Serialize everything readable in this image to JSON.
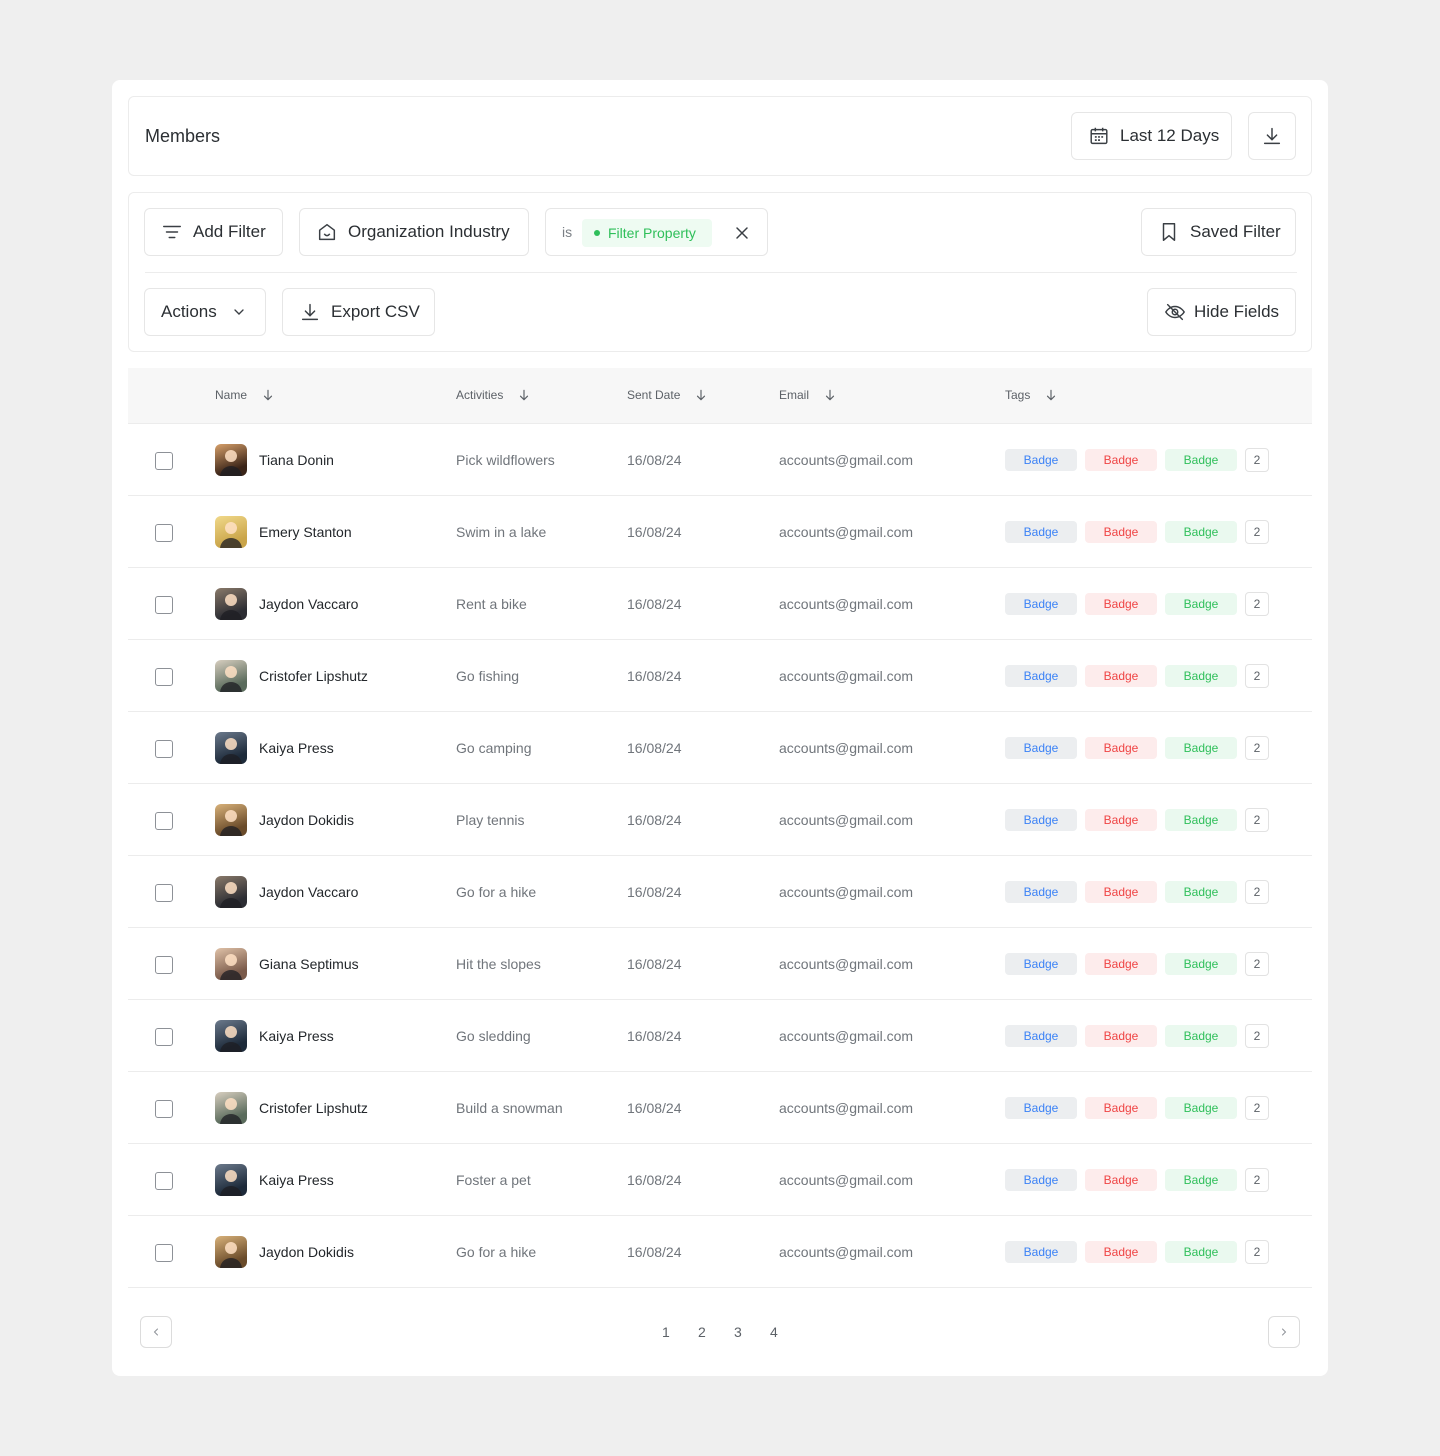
{
  "header": {
    "title": "Members",
    "date_range_label": "Last 12 Days"
  },
  "filters": {
    "add_filter_label": "Add Filter",
    "org_industry_label": "Organization Industry",
    "condition_operator": "is",
    "condition_value": "Filter Property",
    "saved_filter_label": "Saved Filter",
    "actions_label": "Actions",
    "export_csv_label": "Export CSV",
    "hide_fields_label": "Hide Fields"
  },
  "table": {
    "columns": [
      "Name",
      "Activities",
      "Sent Date",
      "Email",
      "Tags"
    ],
    "badge_labels": [
      "Badge",
      "Badge",
      "Badge"
    ],
    "rows": [
      {
        "name": "Tiana Donin",
        "activity": "Pick wildflowers",
        "date": "16/08/24",
        "email": "accounts@gmail.com",
        "tag_count": "2"
      },
      {
        "name": "Emery Stanton",
        "activity": "Swim in a lake",
        "date": "16/08/24",
        "email": "accounts@gmail.com",
        "tag_count": "2"
      },
      {
        "name": "Jaydon Vaccaro",
        "activity": "Rent a bike",
        "date": "16/08/24",
        "email": "accounts@gmail.com",
        "tag_count": "2"
      },
      {
        "name": "Cristofer Lipshutz",
        "activity": "Go fishing",
        "date": "16/08/24",
        "email": "accounts@gmail.com",
        "tag_count": "2"
      },
      {
        "name": "Kaiya Press",
        "activity": "Go camping",
        "date": "16/08/24",
        "email": "accounts@gmail.com",
        "tag_count": "2"
      },
      {
        "name": "Jaydon Dokidis",
        "activity": "Play tennis",
        "date": "16/08/24",
        "email": "accounts@gmail.com",
        "tag_count": "2"
      },
      {
        "name": "Jaydon Vaccaro",
        "activity": "Go for a hike",
        "date": "16/08/24",
        "email": "accounts@gmail.com",
        "tag_count": "2"
      },
      {
        "name": "Giana Septimus",
        "activity": "Hit the slopes",
        "date": "16/08/24",
        "email": "accounts@gmail.com",
        "tag_count": "2"
      },
      {
        "name": "Kaiya Press",
        "activity": "Go sledding",
        "date": "16/08/24",
        "email": "accounts@gmail.com",
        "tag_count": "2"
      },
      {
        "name": "Cristofer Lipshutz",
        "activity": "Build a snowman",
        "date": "16/08/24",
        "email": "accounts@gmail.com",
        "tag_count": "2"
      },
      {
        "name": "Kaiya Press",
        "activity": "Foster a pet",
        "date": "16/08/24",
        "email": "accounts@gmail.com",
        "tag_count": "2"
      },
      {
        "name": "Jaydon Dokidis",
        "activity": "Go for a hike",
        "date": "16/08/24",
        "email": "accounts@gmail.com",
        "tag_count": "2"
      }
    ]
  },
  "pagination": {
    "pages": [
      "1",
      "2",
      "3",
      "4"
    ]
  },
  "colors": {
    "badge_blue": "#3b82f6",
    "badge_red": "#ef4444",
    "badge_green": "#2fbf5a"
  }
}
